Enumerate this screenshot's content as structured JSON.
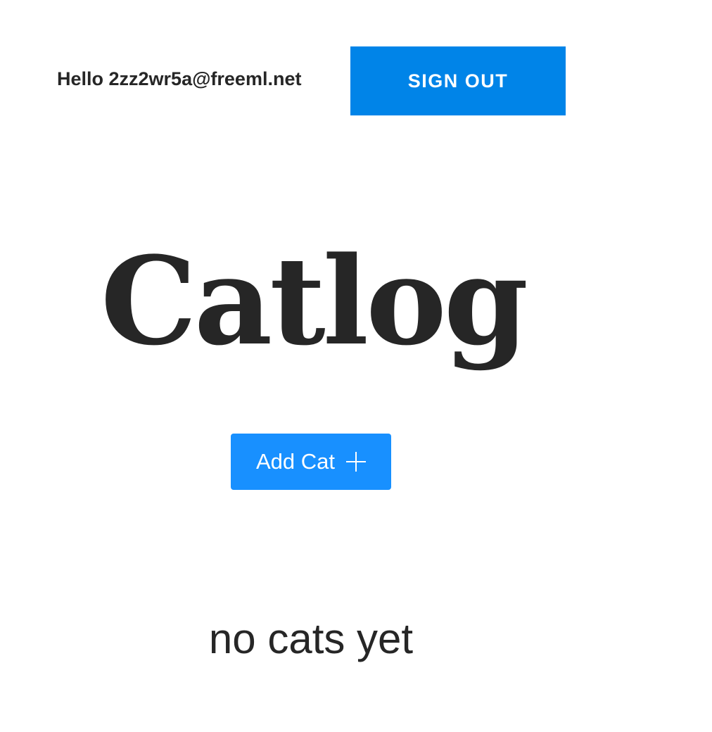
{
  "header": {
    "greeting": "Hello 2zz2wr5a@freeml.net",
    "signout_label": "SIGN OUT"
  },
  "main": {
    "title": "Catlog",
    "add_button_label": "Add Cat",
    "add_button_icon": "plus-icon",
    "empty_message": "no cats yet"
  },
  "colors": {
    "signout_bg": "#0084e8",
    "add_button_bg": "#1890ff",
    "text": "#262626"
  }
}
